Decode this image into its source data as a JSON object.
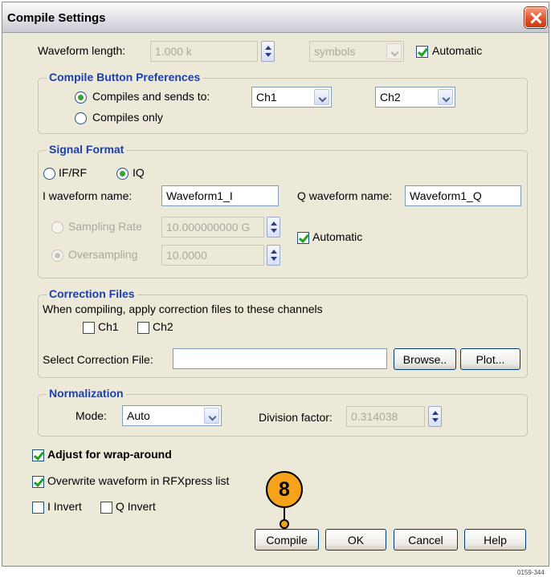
{
  "window": {
    "title": "Compile Settings"
  },
  "waveform": {
    "length_label": "Waveform length:",
    "length_value": "1.000 k",
    "unit_value": "symbols",
    "automatic_label": "Automatic",
    "automatic_checked": true
  },
  "compile_prefs": {
    "legend": "Compile Button Preferences",
    "option_sends": "Compiles and sends to:",
    "option_only": "Compiles only",
    "selected": "sends",
    "channel_a": "Ch1",
    "channel_b": "Ch2"
  },
  "signal_format": {
    "legend": "Signal Format",
    "option_ifrf": "IF/RF",
    "option_iq": "IQ",
    "selected": "IQ",
    "i_label": "I waveform name:",
    "i_value": "Waveform1_I",
    "q_label": "Q waveform name:",
    "q_value": "Waveform1_Q",
    "sampling_rate_label": "Sampling Rate",
    "sampling_rate_value": "10.000000000 G",
    "oversampling_label": "Oversampling",
    "oversampling_value": "10.0000",
    "automatic_label": "Automatic",
    "automatic_checked": true
  },
  "correction": {
    "legend": "Correction Files",
    "description": "When compiling, apply correction files to these channels",
    "ch1_label": "Ch1",
    "ch2_label": "Ch2",
    "ch1_checked": false,
    "ch2_checked": false,
    "file_label": "Select Correction File:",
    "file_value": "",
    "browse_label": "Browse..",
    "plot_label": "Plot..."
  },
  "normalization": {
    "legend": "Normalization",
    "mode_label": "Mode:",
    "mode_value": "Auto",
    "division_label": "Division factor:",
    "division_value": "0.314038"
  },
  "options": {
    "wrap_label": "Adjust for wrap-around",
    "wrap_checked": true,
    "overwrite_label": "Overwrite waveform in RFXpress list",
    "overwrite_checked": true,
    "i_invert_label": "I Invert",
    "q_invert_label": "Q Invert",
    "i_invert_checked": false,
    "q_invert_checked": false
  },
  "buttons": {
    "compile": "Compile",
    "ok": "OK",
    "cancel": "Cancel",
    "help": "Help"
  },
  "callout": {
    "number": "8"
  },
  "figure_number": "0159-344",
  "colors": {
    "legend": "#1d3fa8",
    "callout": "#f6a21a",
    "dialog_bg": "#ece9d8"
  }
}
